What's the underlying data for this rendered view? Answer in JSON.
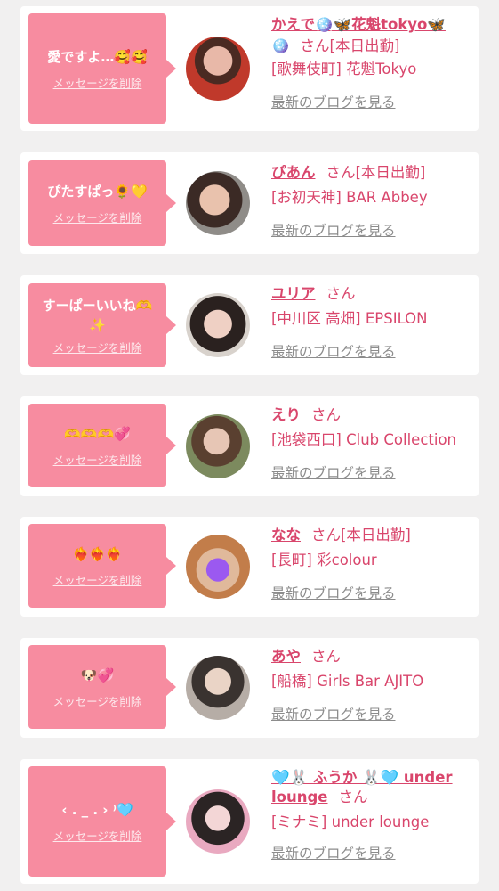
{
  "delete_label": "メッセージを削除",
  "blog_label": "最新のブログを見る",
  "cards": [
    {
      "message": "愛ですよ…🥰🥰",
      "name": "かえで🪩🦋花魁tokyo🦋",
      "name_extra": "🪩",
      "san": "さん",
      "status": "[本日出勤]",
      "shop": "[歌舞伎町] 花魁Tokyo"
    },
    {
      "message": "ぴたすぱっ🌻💛",
      "name": "ぴあん",
      "san": "さん",
      "status": "[本日出勤]",
      "shop": "[お初天神] BAR Abbey"
    },
    {
      "message": "すーぱーいいね🫶✨",
      "name": "ユリア",
      "san": "さん",
      "status": "",
      "shop": "[中川区 高畑] EPSILON"
    },
    {
      "message": "🫶🫶🫶💞",
      "name": "えり",
      "san": "さん",
      "status": "",
      "shop": "[池袋西口] Club Collection"
    },
    {
      "message": "❤️‍🔥❤️‍🔥❤️‍🔥",
      "name": "なな",
      "san": "さん",
      "status": "[本日出勤]",
      "shop": "[長町] 彩colour"
    },
    {
      "message": "🐶💞",
      "name": "あや",
      "san": "さん",
      "status": "",
      "shop": "[船橋] Girls Bar AJITO"
    },
    {
      "message": "‹ . _ . › ⁾🩵",
      "name": "🩵🐰 ふうか 🐰🩵 under lounge",
      "san": "さん",
      "status": "",
      "shop": "[ミナミ] under lounge"
    }
  ],
  "colors": {
    "accent": "#d9466c",
    "bubble": "#f78ca0"
  }
}
